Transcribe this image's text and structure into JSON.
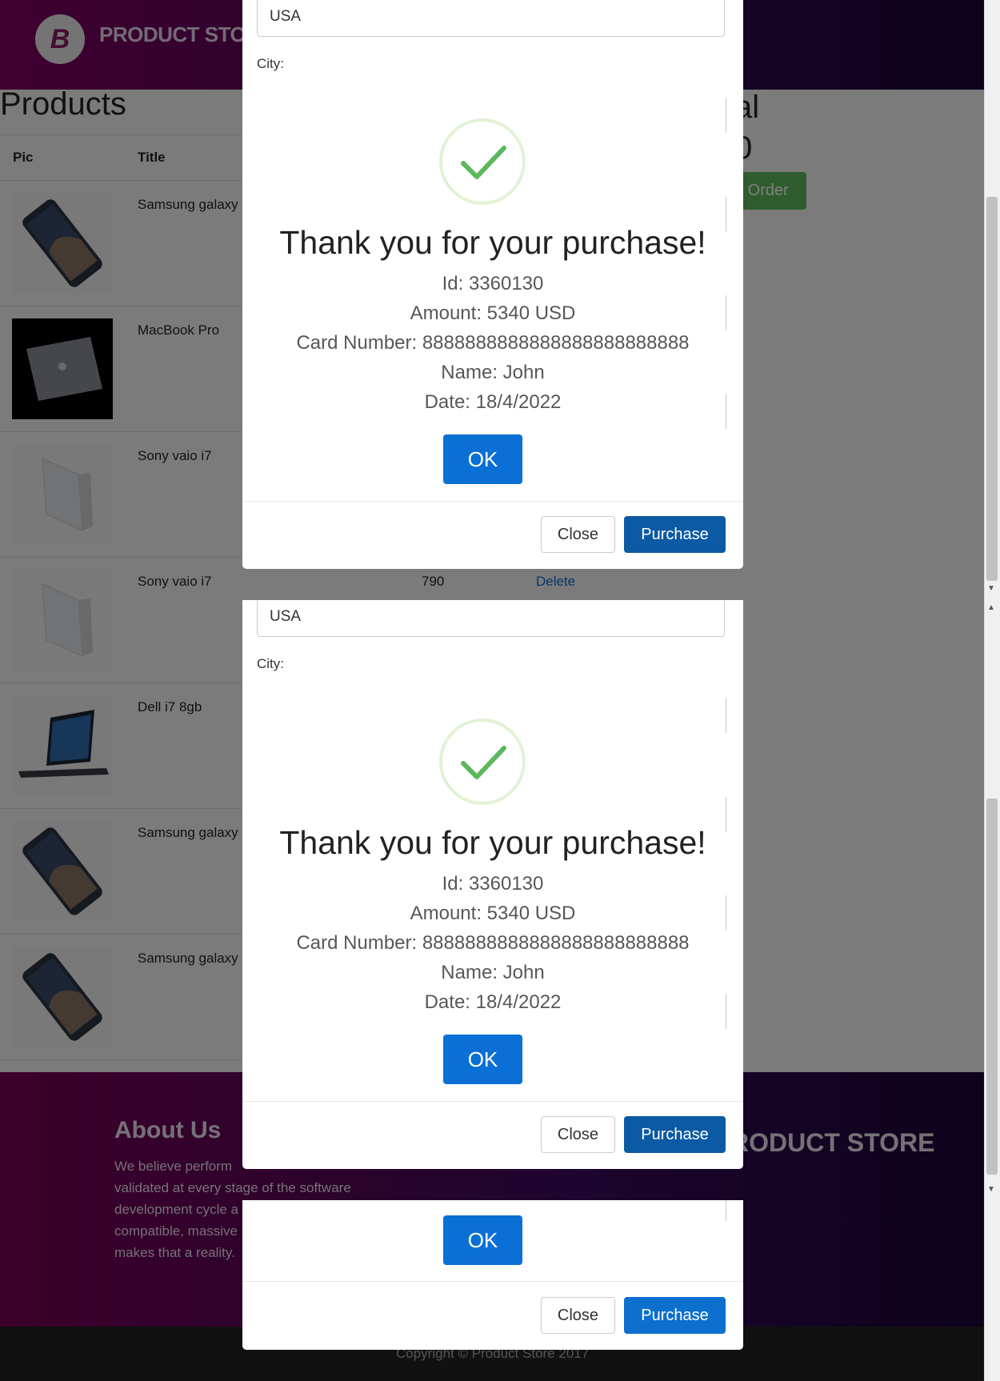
{
  "navbar": {
    "logo_letter": "B",
    "brand": "PRODUCT STORE"
  },
  "products": {
    "heading": "Products",
    "columns": [
      "Pic",
      "Title"
    ],
    "rows": [
      {
        "title": "Samsung galaxy",
        "image": "phone-image"
      },
      {
        "title": "MacBook Pro",
        "image": "laptop-dark-image"
      },
      {
        "title": "Sony vaio i7",
        "image": "laptop-silver-image"
      },
      {
        "title": "Sony vaio i7",
        "price": "790",
        "action": "Delete",
        "image": "laptop-silver-image"
      },
      {
        "title": "Dell i7 8gb",
        "image": "laptop-open-image"
      },
      {
        "title": "Samsung galaxy",
        "image": "phone-image"
      },
      {
        "title": "Samsung galaxy",
        "image": "phone-image"
      }
    ],
    "total_heading_fragment": "al",
    "total_value_fragment": "0",
    "place_order_fragment": "e Order"
  },
  "footer": {
    "about_title": "About Us",
    "about_text_lines": [
      "We believe perform",
      "validated at every stage of the software",
      "development cycle a",
      "compatible, massive",
      "makes that a reality."
    ],
    "brand_fragment": "RODUCT STORE",
    "copyright": "Copyright © Product Store 2017"
  },
  "modal_top": {
    "country_value": "USA",
    "city_label": "City:",
    "close_label": "Close",
    "purchase_label": "Purchase"
  },
  "alert_top": {
    "title": "Thank you for your purchase!",
    "id_line": "Id: 3360130",
    "amount_line": "Amount: 5340 USD",
    "card_line": "Card Number: 8888888888888888888888888",
    "name_line": "Name: John",
    "date_line": "Date: 18/4/2022",
    "ok_label": "OK"
  },
  "modal_mid": {
    "country_value": "USA",
    "city_label": "City:",
    "close_label": "Close",
    "purchase_label": "Purchase"
  },
  "alert_mid": {
    "title": "Thank you for your purchase!",
    "id_line": "Id: 3360130",
    "amount_line": "Amount: 5340 USD",
    "card_line": "Card Number: 8888888888888888888888888",
    "name_line": "Name: John",
    "date_line": "Date: 18/4/2022",
    "ok_label": "OK"
  },
  "modal_bottom": {
    "ok_label": "OK",
    "close_label": "Close",
    "purchase_label": "Purchase"
  },
  "colors": {
    "accent_blue": "#0a70d6",
    "purchase_blue": "#0b5aa3",
    "success_green": "#5cb85c",
    "navbar_start": "#800060",
    "navbar_end": "#1a0638"
  }
}
